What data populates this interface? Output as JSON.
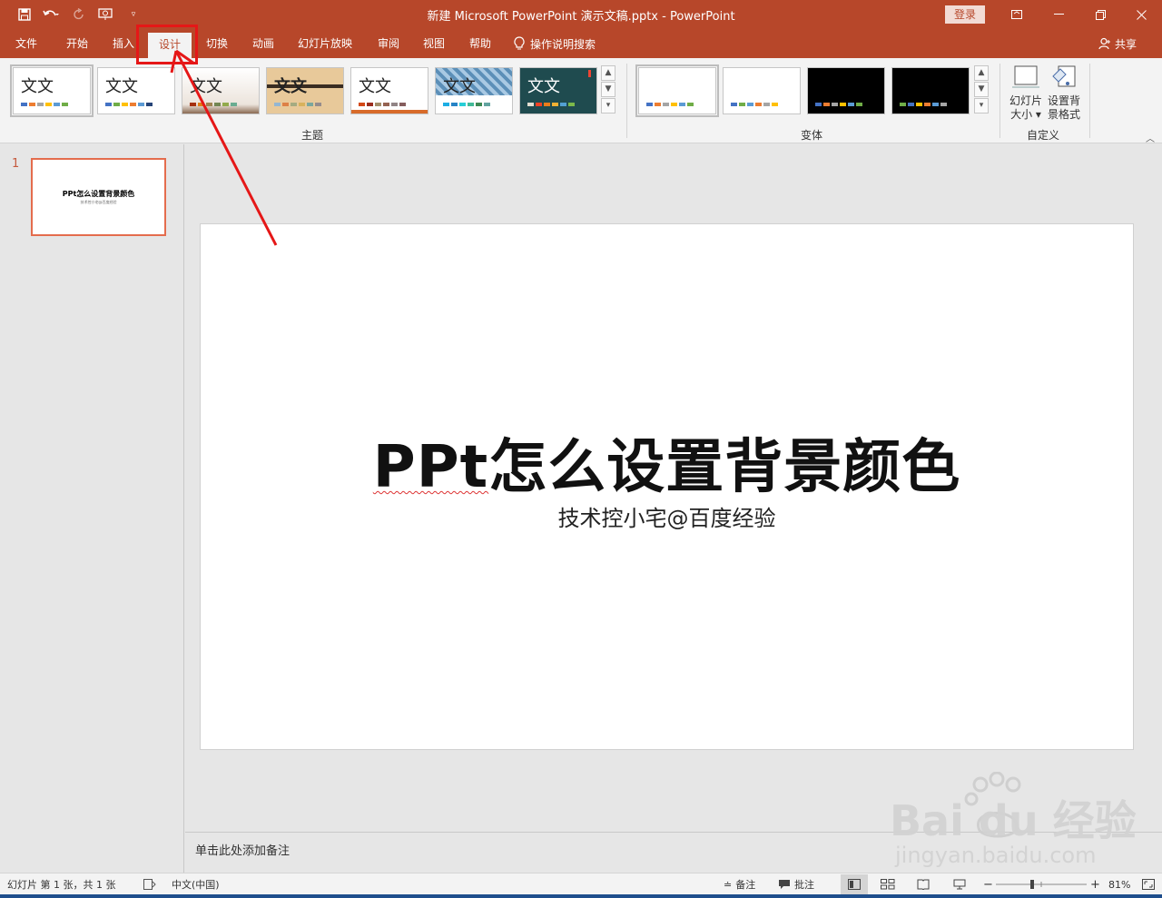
{
  "app": {
    "window_title": "新建 Microsoft PowerPoint 演示文稿.pptx  -  PowerPoint",
    "login_label": "登录",
    "accent_color": "#b7472a"
  },
  "tabs": [
    {
      "label": "文件"
    },
    {
      "label": "开始"
    },
    {
      "label": "插入"
    },
    {
      "label": "设计",
      "active": true
    },
    {
      "label": "切换"
    },
    {
      "label": "动画"
    },
    {
      "label": "幻灯片放映"
    },
    {
      "label": "审阅"
    },
    {
      "label": "视图"
    },
    {
      "label": "帮助"
    }
  ],
  "tell_me": "操作说明搜索",
  "share": "共享",
  "ribbon": {
    "themes_group": "主题",
    "variants_group": "变体",
    "customize_group": "自定义",
    "themes": [
      {
        "label": "文文",
        "bg": "#ffffff",
        "text": "#222222"
      },
      {
        "label": "文文",
        "bg": "#ffffff",
        "text": "#222222"
      },
      {
        "label": "文文",
        "bg": "#efe9e4",
        "text": "#222222"
      },
      {
        "label": "文文",
        "bg": "#e8c99a",
        "text": "#222222"
      },
      {
        "label": "文文",
        "bg": "#ffffff",
        "text": "#222222"
      },
      {
        "label": "文文",
        "bg": "#5c8fb8",
        "text": "#222222"
      },
      {
        "label": "文文",
        "bg": "#1f4b4f",
        "text": "#ffffff"
      }
    ],
    "slide_size_label": "幻灯片\n大小",
    "slide_size_line1": "幻灯片",
    "slide_size_line2": "大小 ▾",
    "format_bg_line1": "设置背",
    "format_bg_line2": "景格式"
  },
  "thumbnail": {
    "number": "1",
    "title": "PPt怎么设置背景颜色",
    "subtitle": "技术控小宅@百度经验"
  },
  "slide": {
    "title_pre": "PPt",
    "title_rest": "怎么设置背景颜色",
    "subtitle": "技术控小宅@百度经验"
  },
  "notes_placeholder": "单击此处添加备注",
  "status": {
    "slide_info": "幻灯片 第 1 张，共 1 张",
    "language": "中文(中国)",
    "notes": "备注",
    "comments": "批注",
    "zoom": "81%"
  },
  "watermark": {
    "logo": "Bai du 经验",
    "url": "jingyan.baidu.com"
  }
}
